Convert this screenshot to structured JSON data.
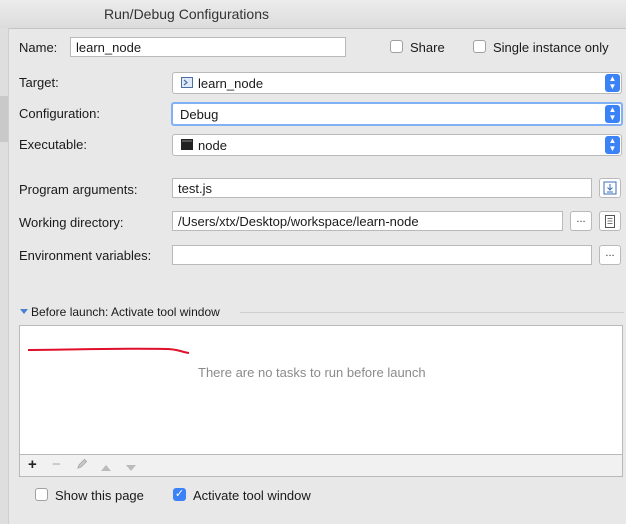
{
  "window": {
    "title": "Run/Debug Configurations"
  },
  "name": {
    "label": "Name:",
    "value": "learn_node"
  },
  "share": {
    "label": "Share",
    "checked": false
  },
  "single_instance": {
    "label": "Single instance only",
    "checked": false
  },
  "target": {
    "label": "Target:",
    "value": "learn_node",
    "icon": "module-icon"
  },
  "configuration": {
    "label": "Configuration:",
    "value": "Debug"
  },
  "executable": {
    "label": "Executable:",
    "value": "node",
    "icon": "terminal-icon"
  },
  "program_arguments": {
    "label": "Program arguments:",
    "value": "test.js"
  },
  "working_directory": {
    "label": "Working directory:",
    "value": "/Users/xtx/Desktop/workspace/learn-node",
    "browse": "..."
  },
  "environment_variables": {
    "label": "Environment variables:",
    "value": "",
    "browse": "..."
  },
  "before_launch": {
    "title": "Before launch: Activate tool window",
    "empty_text": "There are no tasks to run before launch",
    "toolbar": [
      "add-icon",
      "remove-icon",
      "edit-icon",
      "move-up-icon",
      "move-down-icon"
    ]
  },
  "show_this_page": {
    "label": "Show this page",
    "checked": false
  },
  "activate_tool_window": {
    "label": "Activate tool window",
    "checked": true
  },
  "colors": {
    "accent": "#3b82f6",
    "annotation": "#e0102a"
  }
}
